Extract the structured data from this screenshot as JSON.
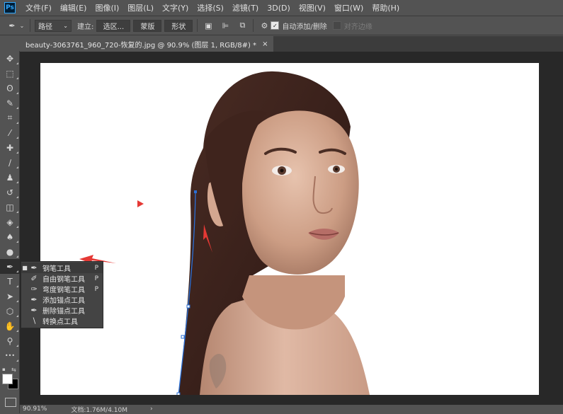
{
  "app": {
    "logo": "Ps"
  },
  "menu": [
    "文件(F)",
    "编辑(E)",
    "图像(I)",
    "图层(L)",
    "文字(Y)",
    "选择(S)",
    "滤镜(T)",
    "3D(D)",
    "视图(V)",
    "窗口(W)",
    "帮助(H)"
  ],
  "options": {
    "mode_select": "路径",
    "make_label": "建立:",
    "selection_button": "选区...",
    "mask_button": "蒙版",
    "shape_button": "形状",
    "auto_add_delete_label": "自动添加/删除",
    "auto_add_delete_checked": true,
    "align_edges_label": "对齐边缘",
    "align_edges_checked": false
  },
  "document_tab": {
    "title": "beauty-3063761_960_720-恢复的.jpg @ 90.9% (图层 1, RGB/8#) *",
    "close": "×"
  },
  "tools": [
    {
      "name": "move-tool-icon",
      "glyph": "✥"
    },
    {
      "name": "marquee-tool-icon",
      "glyph": "⬚"
    },
    {
      "name": "lasso-tool-icon",
      "glyph": "ʘ"
    },
    {
      "name": "quick-select-tool-icon",
      "glyph": "✎"
    },
    {
      "name": "crop-tool-icon",
      "glyph": "⌗"
    },
    {
      "name": "eyedropper-tool-icon",
      "glyph": "⁄"
    },
    {
      "name": "healing-brush-tool-icon",
      "glyph": "✚"
    },
    {
      "name": "brush-tool-icon",
      "glyph": "∕"
    },
    {
      "name": "stamp-tool-icon",
      "glyph": "♟"
    },
    {
      "name": "history-brush-tool-icon",
      "glyph": "↺"
    },
    {
      "name": "eraser-tool-icon",
      "glyph": "◫"
    },
    {
      "name": "paint-bucket-tool-icon",
      "glyph": "◈"
    },
    {
      "name": "blur-tool-icon",
      "glyph": "♠"
    },
    {
      "name": "dodge-tool-icon",
      "glyph": "●"
    },
    {
      "name": "pen-tool-icon",
      "glyph": "✒"
    },
    {
      "name": "type-tool-icon",
      "glyph": "T"
    },
    {
      "name": "path-select-tool-icon",
      "glyph": "➤"
    },
    {
      "name": "shape-tool-icon",
      "glyph": "⬡"
    },
    {
      "name": "hand-tool-icon",
      "glyph": "✋"
    },
    {
      "name": "zoom-tool-icon",
      "glyph": "⚲"
    },
    {
      "name": "more-tools-icon",
      "glyph": "•••"
    }
  ],
  "pen_flyout": [
    {
      "label": "钢笔工具",
      "key": "P",
      "selected": true
    },
    {
      "label": "自由钢笔工具",
      "key": "P",
      "selected": false
    },
    {
      "label": "弯度钢笔工具",
      "key": "P",
      "selected": false
    },
    {
      "label": "添加锚点工具",
      "key": "",
      "selected": false
    },
    {
      "label": "删除锚点工具",
      "key": "",
      "selected": false
    },
    {
      "label": "转换点工具",
      "key": "",
      "selected": false
    }
  ],
  "status": {
    "zoom": "90.91%",
    "doc": "文档:1.76M/4.10M",
    "arrow": "›"
  },
  "colors": {
    "annotation_arrow": "#e53935",
    "path_line": "#2a6fd6",
    "foreground": "#ffffff",
    "background": "#000000"
  }
}
